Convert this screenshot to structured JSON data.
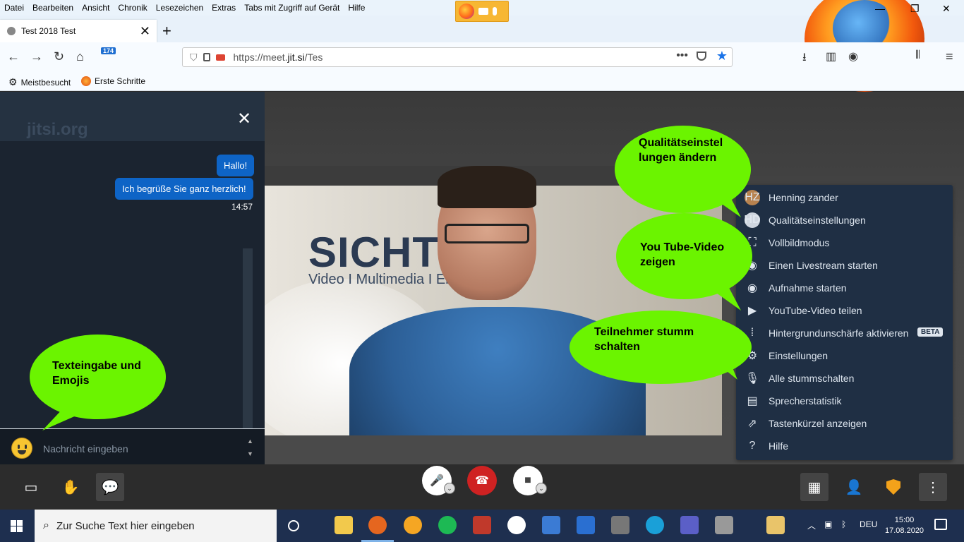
{
  "menubar": {
    "items": [
      "Datei",
      "Bearbeiten",
      "Ansicht",
      "Chronik",
      "Lesezeichen",
      "Extras",
      "Tabs mit Zugriff auf Gerät",
      "Hilfe"
    ]
  },
  "browser": {
    "tab_title": "Test 2018 Test",
    "badge_count": "174",
    "url_prefix": "https://meet.",
    "url_domain": "jit.si",
    "url_path": "/Tes",
    "bookmarks": [
      "Meistbesucht",
      "Erste Schritte"
    ]
  },
  "chat": {
    "watermark": "jitsi.org",
    "messages": [
      {
        "text": "Hallo!"
      },
      {
        "text": "Ich begrüße Sie ganz herzlich!"
      }
    ],
    "time": "14:57",
    "input_placeholder": "Nachricht eingeben"
  },
  "video": {
    "wall_text": "SICHT",
    "wall_sub": "Video I Multimedia I En"
  },
  "menu": {
    "items": [
      {
        "label": "Henning zander",
        "icon": "HZ"
      },
      {
        "label": "Qualitätseinstellungen",
        "icon": "HD"
      },
      {
        "label": "Vollbildmodus",
        "icon": "fullscreen-icon"
      },
      {
        "label": "Einen Livestream starten",
        "icon": "livestream-icon"
      },
      {
        "label": "Aufnahme starten",
        "icon": "record-icon"
      },
      {
        "label": "YouTube-Video teilen",
        "icon": "play-icon"
      },
      {
        "label": "Hintergrundunschärfe aktivieren",
        "icon": "blur-icon",
        "badge": "BETA"
      },
      {
        "label": "Einstellungen",
        "icon": "gear-icon"
      },
      {
        "label": "Alle stummschalten",
        "icon": "mute-all-icon"
      },
      {
        "label": "Sprecherstatistik",
        "icon": "stats-icon"
      },
      {
        "label": "Tastenkürzel anzeigen",
        "icon": "shortcut-icon"
      },
      {
        "label": "Hilfe",
        "icon": "help-icon"
      }
    ]
  },
  "bubbles": {
    "quality": [
      "Qualitätseinstel",
      "lungen ändern"
    ],
    "youtube": [
      "You Tube-Video",
      "zeigen"
    ],
    "mute": [
      "Teilnehmer stumm",
      "schalten"
    ],
    "text": [
      "Texteingabe und",
      "Emojis"
    ]
  },
  "taskbar": {
    "search_placeholder": "Zur Suche Text hier eingeben",
    "lang": "DEU",
    "time": "15:00",
    "date": "17.08.2020"
  },
  "colors": {
    "bubble_green": "#6bf400",
    "chat_bubble_blue": "#0e64c6",
    "menu_bg": "#1f2f44",
    "hangup_red": "#cf2222"
  }
}
